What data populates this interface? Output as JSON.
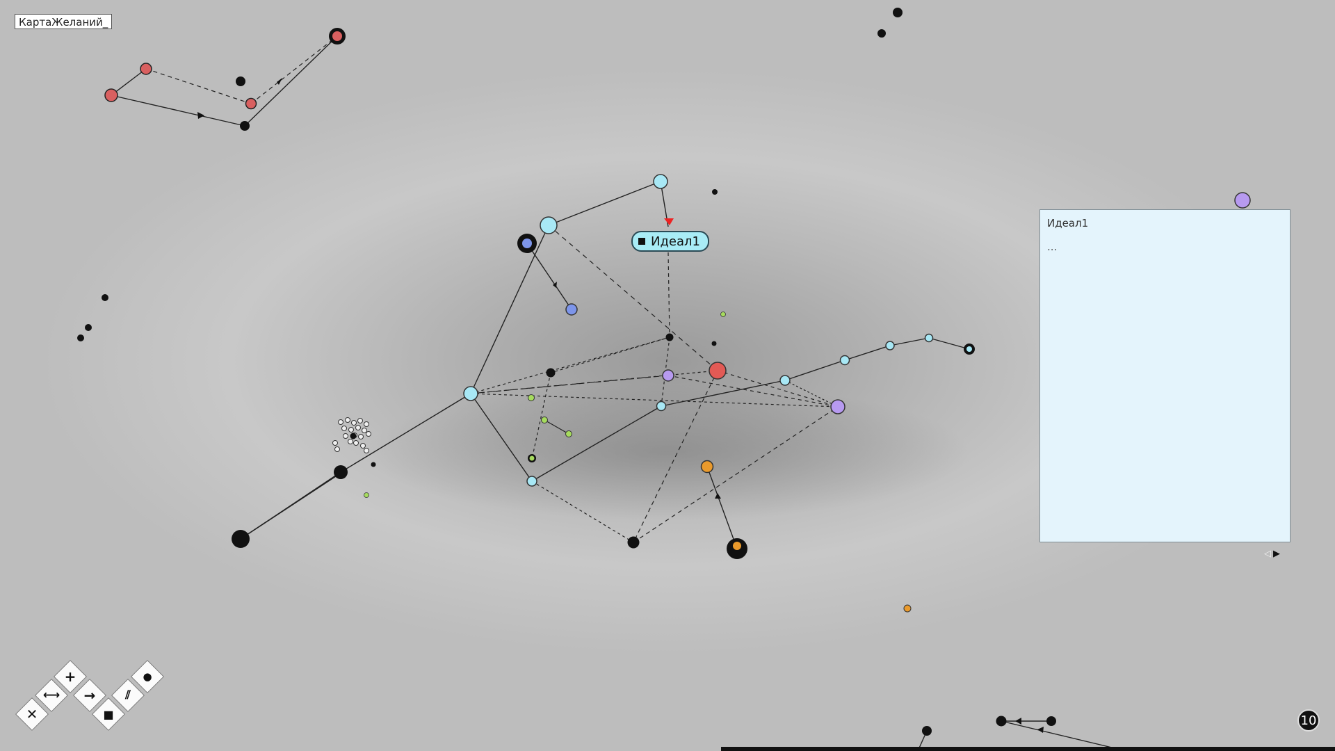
{
  "window": {
    "title": "КартаЖеланий_"
  },
  "selected_node": {
    "label": "Идеал1"
  },
  "details_panel": {
    "title": "Идеал1",
    "body": "..."
  },
  "pager": {
    "prev": "◁",
    "next": "▶"
  },
  "toolbar": {
    "tools": [
      {
        "name": "add-tool",
        "glyph": "+"
      },
      {
        "name": "link-tool",
        "glyph": "⟷"
      },
      {
        "name": "arrow-tool",
        "glyph": "→"
      },
      {
        "name": "fill-tool",
        "glyph": "●"
      },
      {
        "name": "delete-tool",
        "glyph": "✕"
      },
      {
        "name": "group-tool",
        "glyph": "■"
      },
      {
        "name": "parallel-tool",
        "glyph": "⫽"
      }
    ]
  },
  "counter": {
    "value": "10"
  },
  "colors": {
    "cyan": "#a8e8f5",
    "red": "#e25a55",
    "purple": "#b79af0",
    "blue": "#7d95ea",
    "orange": "#ea9a2c",
    "green": "#a6db5e",
    "black": "#111111",
    "panel": "#e4f4fc"
  }
}
